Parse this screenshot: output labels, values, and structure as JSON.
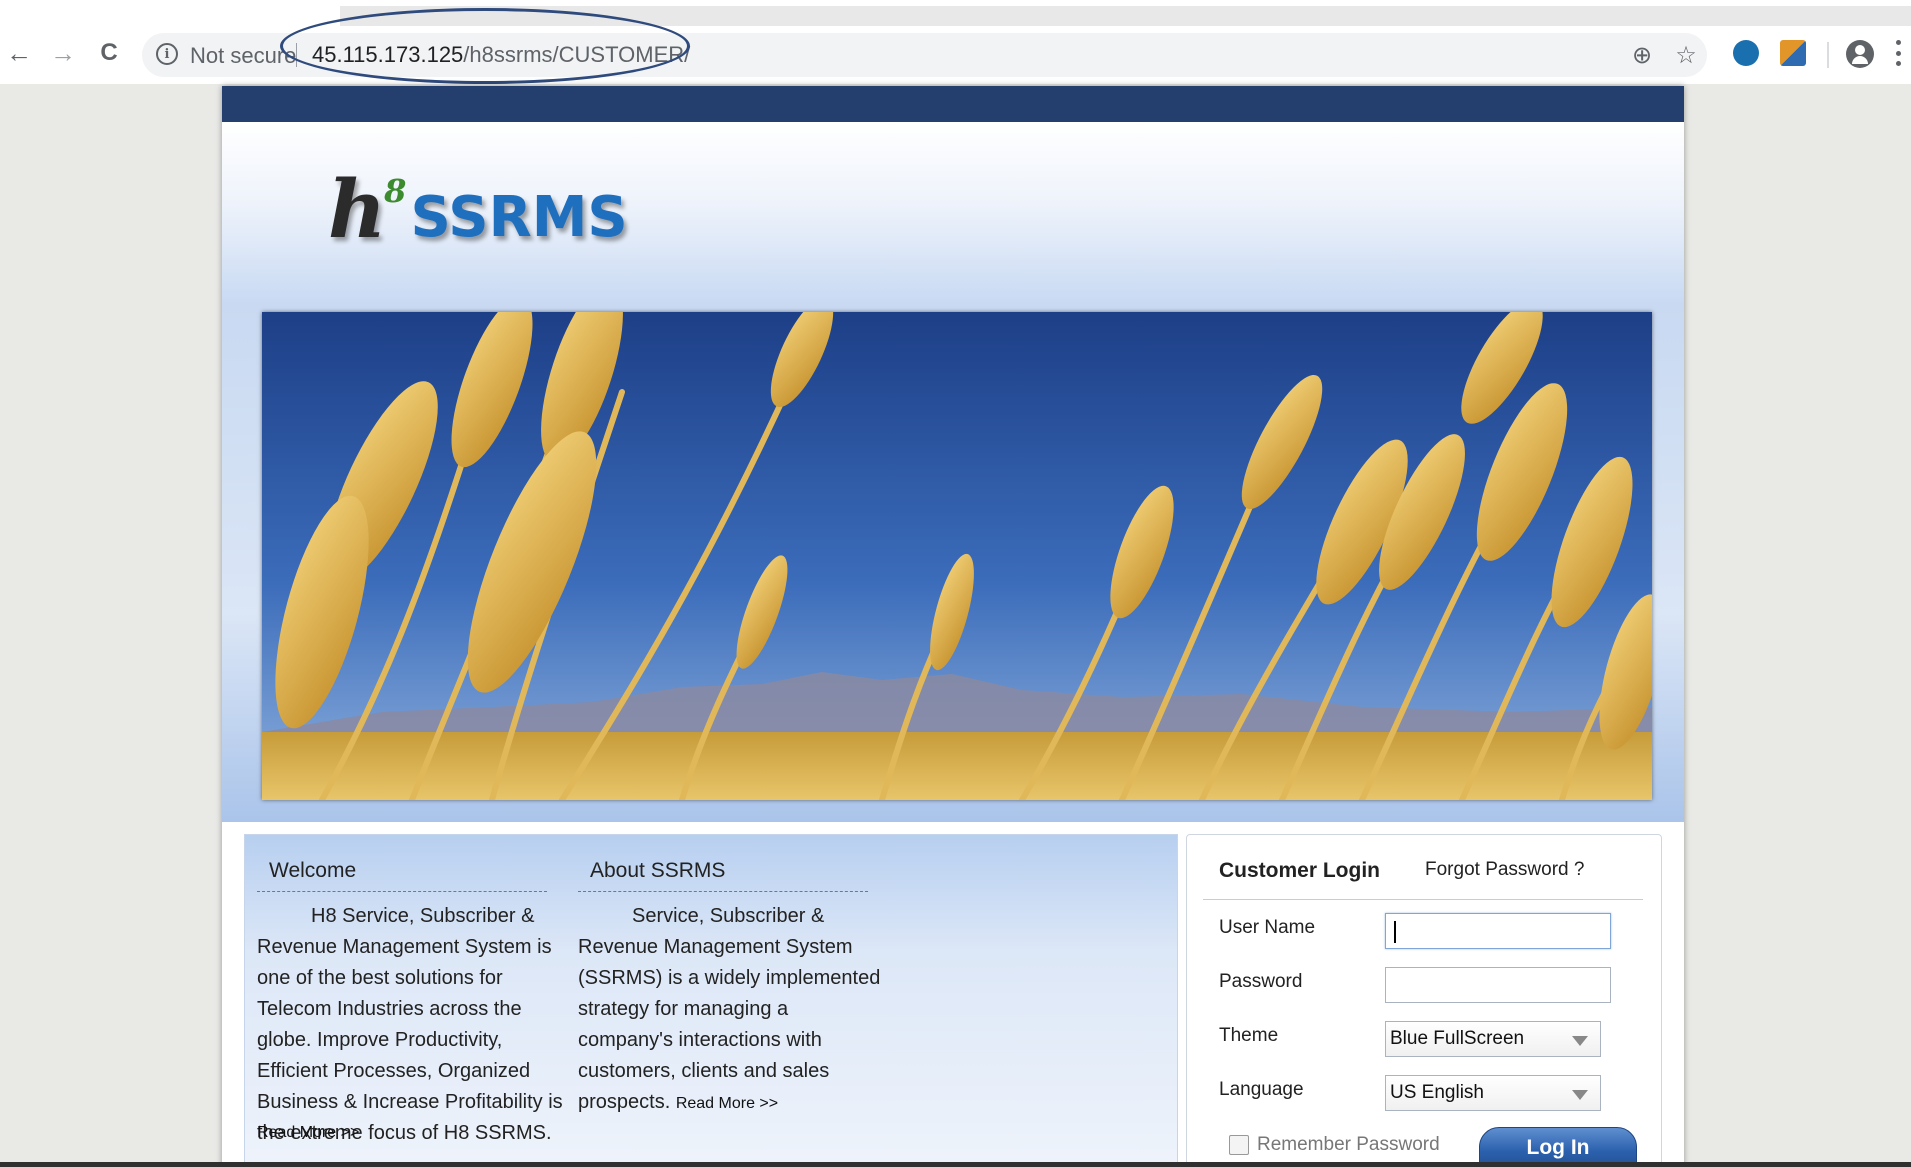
{
  "browser": {
    "back_icon": "←",
    "forward_icon": "→",
    "reload_icon": "C",
    "security_text": "Not secure",
    "url_host": "45.115.173.125",
    "url_path": "/h8ssrms/CUSTOMER/",
    "zoom_icon": "⊕",
    "star_icon": "☆"
  },
  "header": {
    "logo_h": "h",
    "logo_sup": "8",
    "logo_word": "SSRMS"
  },
  "welcome": {
    "title": "Welcome",
    "body": "H8 Service, Subscriber & Revenue Management System is one of the best solutions for Telecom Industries across the globe. Improve Productivity, Efficient Processes, Organized Business & Increase Profitability is the extreme focus of H8 SSRMS.",
    "read_more": "Read More >>"
  },
  "about": {
    "title": "About SSRMS",
    "body": "Service, Subscriber & Revenue Management System (SSRMS) is a widely implemented strategy for managing a company's interactions with customers, clients and sales prospects.",
    "read_more": "Read More >>"
  },
  "login": {
    "title": "Customer Login",
    "forgot": "Forgot Password ?",
    "username_label": "User Name",
    "username_value": "",
    "password_label": "Password",
    "password_value": "",
    "theme_label": "Theme",
    "theme_value": "Blue FullScreen",
    "language_label": "Language",
    "language_value": "US English",
    "remember_label": "Remember Password",
    "submit_label": "Log In"
  },
  "colors": {
    "topbar": "#243f6e",
    "logo_blue": "#1f6fbf",
    "logo_green": "#3c8b2e",
    "annotation_ellipse": "#2f4a7c"
  }
}
